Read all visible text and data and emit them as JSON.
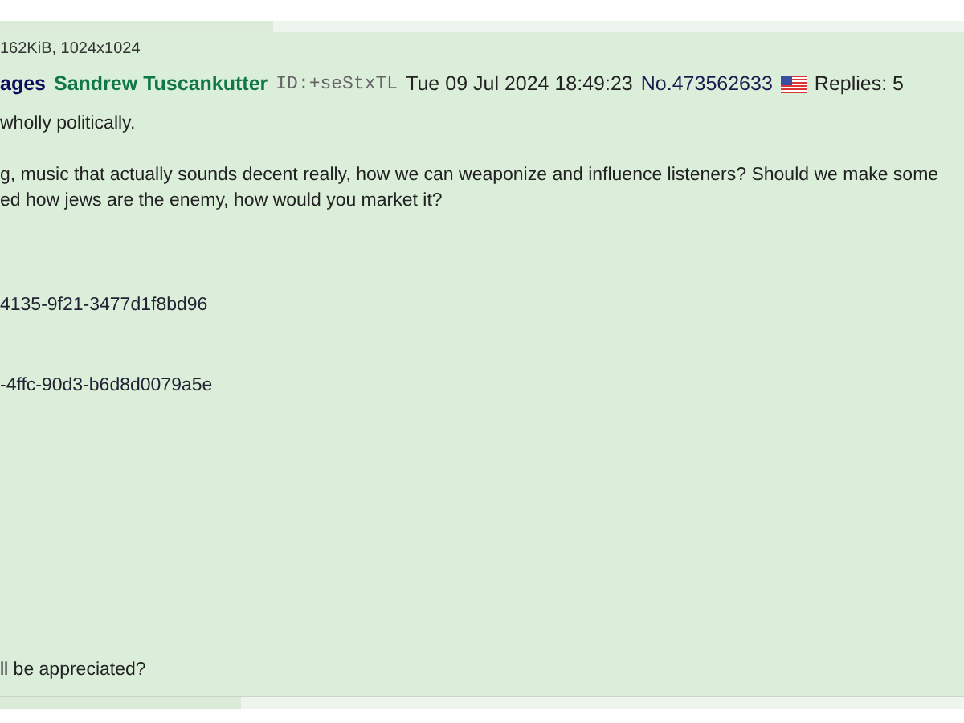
{
  "post": {
    "file_info": "162KiB, 1024x1024",
    "subject": "ages",
    "name": "Sandrew Tuscankutter",
    "poster_id": "ID:+seStxTL",
    "date": "Tue 09 Jul 2024 18:49:23",
    "number": "No.473562633",
    "replies": "Replies: 5",
    "body": [
      {
        "kind": "text",
        "text": "wholly politically."
      },
      {
        "kind": "text",
        "text": "g, music that actually sounds decent really, how we can weaponize and influence listeners? Should we make some"
      },
      {
        "kind": "text",
        "text": "ed how jews are the enemy, how would you market it?"
      },
      {
        "kind": "link",
        "text": "4135-9f21-3477d1f8bd96"
      },
      {
        "kind": "link",
        "text": "-4ffc-90d3-b6d8d0079a5e"
      },
      {
        "kind": "text",
        "text": "ll be appreciated?"
      }
    ]
  }
}
